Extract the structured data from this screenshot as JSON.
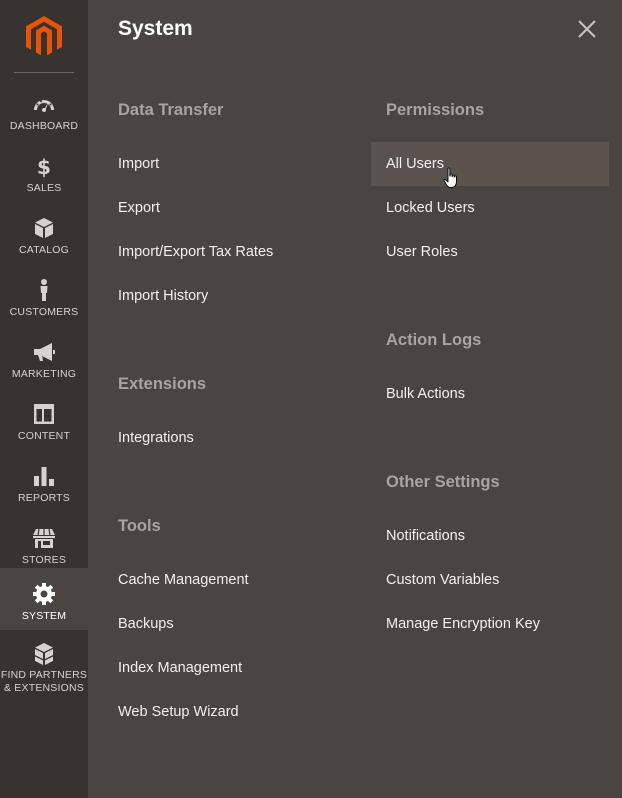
{
  "sidebar": {
    "logo": "magento-logo",
    "items": [
      {
        "label": "DASHBOARD",
        "icon": "dashboard-icon"
      },
      {
        "label": "SALES",
        "icon": "dollar-icon"
      },
      {
        "label": "CATALOG",
        "icon": "box-icon"
      },
      {
        "label": "CUSTOMERS",
        "icon": "person-icon"
      },
      {
        "label": "MARKETING",
        "icon": "megaphone-icon"
      },
      {
        "label": "CONTENT",
        "icon": "layout-icon"
      },
      {
        "label": "REPORTS",
        "icon": "bar-chart-icon"
      },
      {
        "label": "STORES",
        "icon": "store-icon"
      },
      {
        "label": "SYSTEM",
        "icon": "gear-icon",
        "active": true
      },
      {
        "label_line1": "FIND PARTNERS",
        "label_line2": "& EXTENSIONS",
        "icon": "blocks-icon"
      }
    ]
  },
  "panel": {
    "title": "System",
    "sections": {
      "data_transfer": {
        "title": "Data Transfer",
        "links": [
          "Import",
          "Export",
          "Import/Export Tax Rates",
          "Import History"
        ]
      },
      "extensions": {
        "title": "Extensions",
        "links": [
          "Integrations"
        ]
      },
      "tools": {
        "title": "Tools",
        "links": [
          "Cache Management",
          "Backups",
          "Index Management",
          "Web Setup Wizard"
        ]
      },
      "permissions": {
        "title": "Permissions",
        "links": [
          "All Users",
          "Locked Users",
          "User Roles"
        ]
      },
      "action_logs": {
        "title": "Action Logs",
        "links": [
          "Bulk Actions"
        ]
      },
      "other_settings": {
        "title": "Other Settings",
        "links": [
          "Notifications",
          "Custom Variables",
          "Manage Encryption Key"
        ]
      }
    }
  },
  "colors": {
    "sidebar_bg": "#373330",
    "panel_bg": "#4a4542",
    "accent": "#eb5202",
    "hover_bg": "#59524d"
  }
}
